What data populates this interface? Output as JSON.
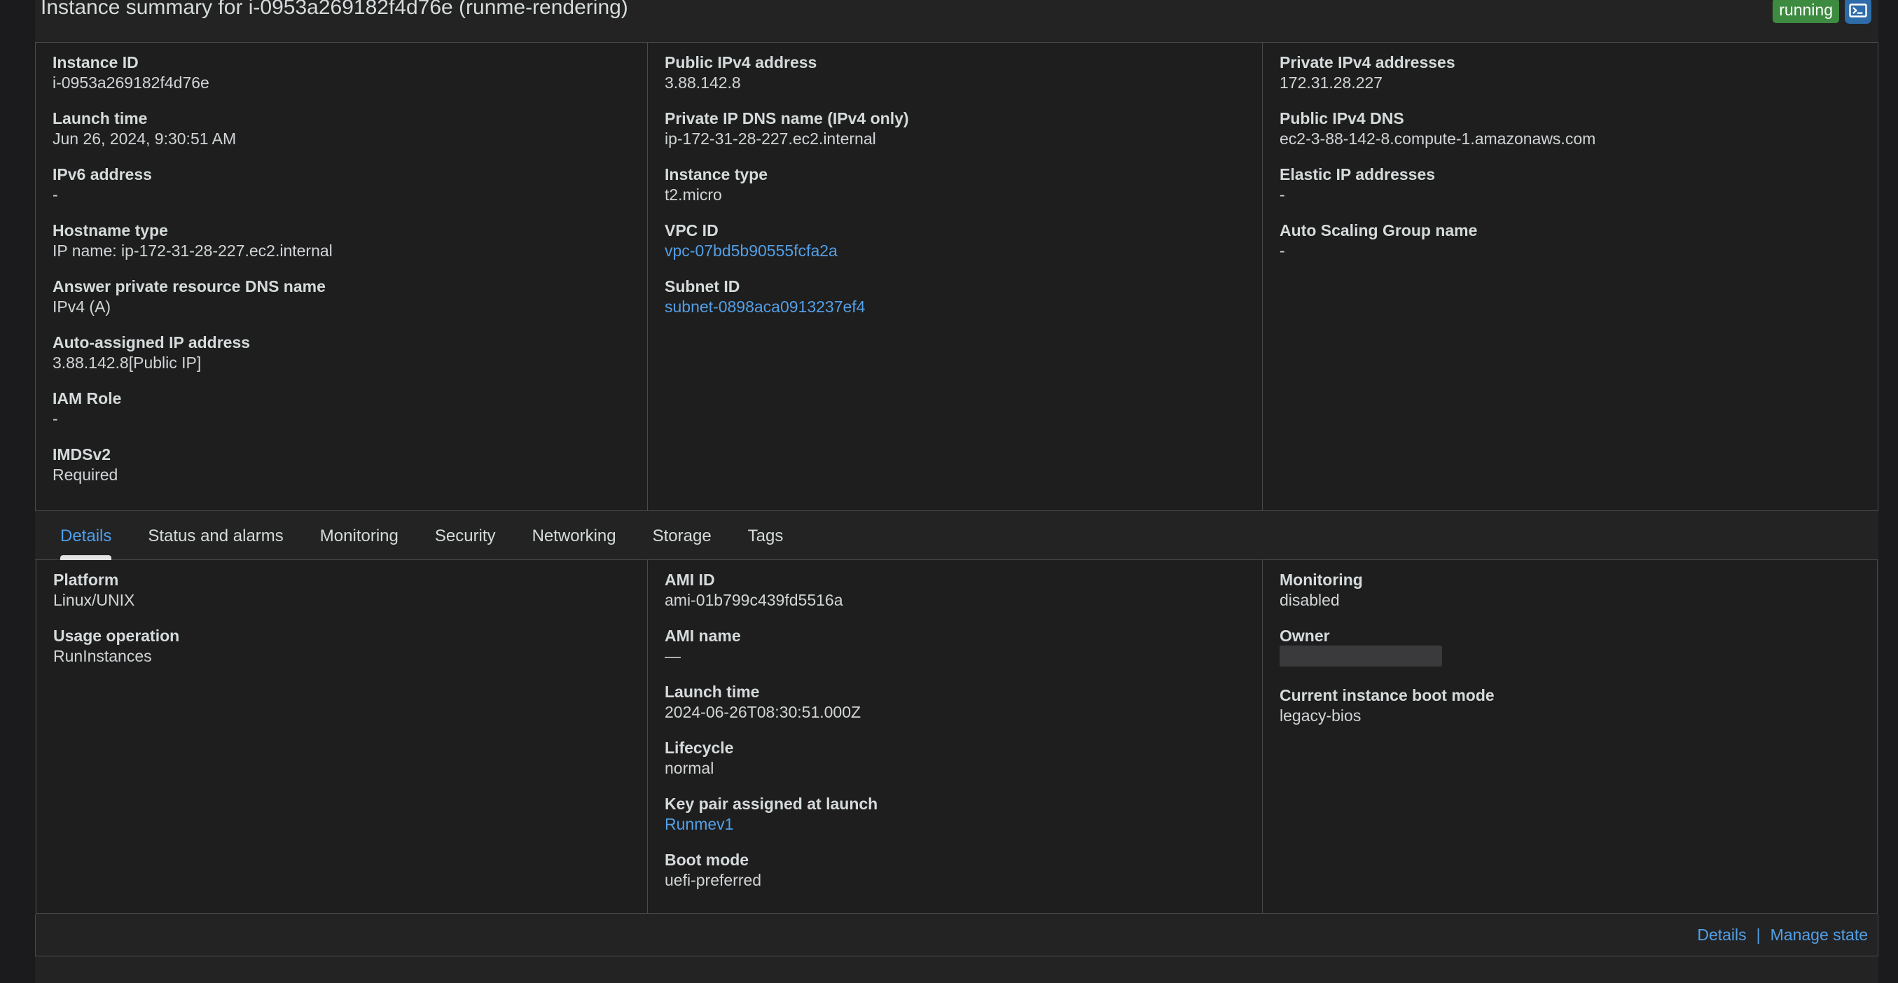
{
  "header": {
    "title": "Instance summary for i-0953a269182f4d76e (runme-rendering)",
    "status": "running",
    "console_icon": "terminal-icon",
    "status_color": "#3d8b40",
    "link_color": "#539fe5"
  },
  "summary": {
    "columns": [
      {
        "fields": [
          {
            "label": "Instance ID",
            "value": "i-0953a269182f4d76e",
            "kind": "text"
          },
          {
            "label": "Launch time",
            "value": "Jun 26, 2024, 9:30:51 AM",
            "kind": "text"
          },
          {
            "label": "IPv6 address",
            "value": "-",
            "kind": "dash"
          },
          {
            "label": "Hostname type",
            "value": "IP name: ip-172-31-28-227.ec2.internal",
            "kind": "text"
          },
          {
            "label": "Answer private resource DNS name",
            "value": "IPv4 (A)",
            "kind": "text"
          },
          {
            "label": "Auto-assigned IP address",
            "value": "3.88.142.8[Public IP]",
            "kind": "text"
          },
          {
            "label": "IAM Role",
            "value": "-",
            "kind": "dash"
          },
          {
            "label": "IMDSv2",
            "value": "Required",
            "kind": "text"
          }
        ]
      },
      {
        "fields": [
          {
            "label": "Public IPv4 address",
            "value": "3.88.142.8",
            "kind": "text"
          },
          {
            "label": "Private IP DNS name (IPv4 only)",
            "value": "ip-172-31-28-227.ec2.internal",
            "kind": "text"
          },
          {
            "label": "Instance type",
            "value": "t2.micro",
            "kind": "text"
          },
          {
            "label": "VPC ID",
            "value": "vpc-07bd5b90555fcfa2a",
            "kind": "link"
          },
          {
            "label": "Subnet ID",
            "value": "subnet-0898aca0913237ef4",
            "kind": "link"
          }
        ]
      },
      {
        "fields": [
          {
            "label": "Private IPv4 addresses",
            "value": "172.31.28.227",
            "kind": "text"
          },
          {
            "label": "Public IPv4 DNS",
            "value": "ec2-3-88-142-8.compute-1.amazonaws.com",
            "kind": "text"
          },
          {
            "label": "Elastic IP addresses",
            "value": "-",
            "kind": "dash"
          },
          {
            "label": "Auto Scaling Group name",
            "value": "-",
            "kind": "dash"
          }
        ]
      }
    ]
  },
  "tabs": [
    {
      "label": "Details",
      "active": true
    },
    {
      "label": "Status and alarms",
      "active": false
    },
    {
      "label": "Monitoring",
      "active": false
    },
    {
      "label": "Security",
      "active": false
    },
    {
      "label": "Networking",
      "active": false
    },
    {
      "label": "Storage",
      "active": false
    },
    {
      "label": "Tags",
      "active": false
    }
  ],
  "details": {
    "columns": [
      {
        "fields": [
          {
            "label": "Platform",
            "value": "Linux/UNIX",
            "kind": "text"
          },
          {
            "label": "Usage operation",
            "value": "RunInstances",
            "kind": "text"
          }
        ]
      },
      {
        "fields": [
          {
            "label": "AMI ID",
            "value": "ami-01b799c439fd5516a",
            "kind": "text"
          },
          {
            "label": "AMI name",
            "value": "—",
            "kind": "dash"
          },
          {
            "label": "Launch time",
            "value": "2024-06-26T08:30:51.000Z",
            "kind": "text"
          },
          {
            "label": "Lifecycle",
            "value": "normal",
            "kind": "text"
          },
          {
            "label": "Key pair assigned at launch",
            "value": "Runmev1",
            "kind": "link"
          },
          {
            "label": "Boot mode",
            "value": "uefi-preferred",
            "kind": "text"
          }
        ]
      },
      {
        "fields": [
          {
            "label": "Monitoring",
            "value": "disabled",
            "kind": "text"
          },
          {
            "label": "Owner",
            "value": "",
            "kind": "redacted"
          },
          {
            "label": "Current instance boot mode",
            "value": "legacy-bios",
            "kind": "text"
          }
        ]
      }
    ]
  },
  "footer": {
    "details_link": "Details",
    "separator": "|",
    "manage_state_link": "Manage state"
  }
}
